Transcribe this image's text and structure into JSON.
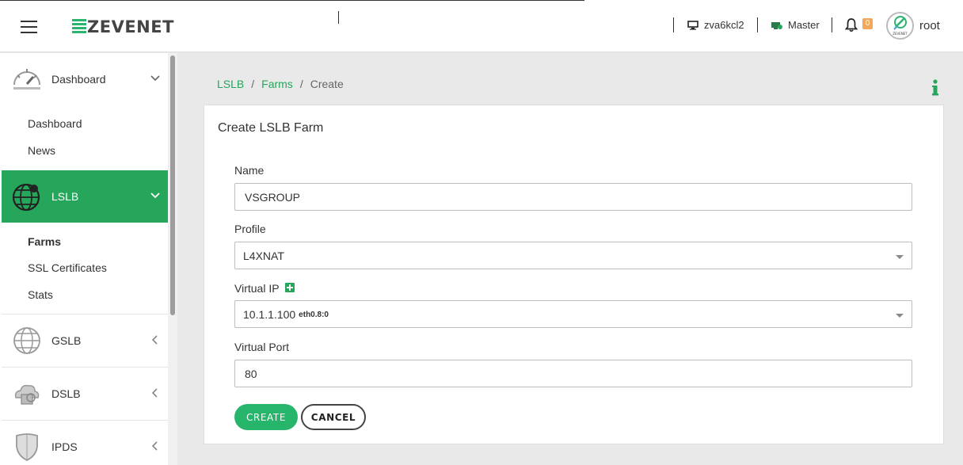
{
  "header": {
    "logo_text": "ZEVENET",
    "host": "zva6kcl2",
    "cluster_role": "Master",
    "notification_count": "0",
    "user": "root",
    "avatar_text": "ZEVENET"
  },
  "sidebar": {
    "sections": [
      {
        "label": "Dashboard",
        "items": [
          "Dashboard",
          "News"
        ]
      },
      {
        "label": "LSLB",
        "items": [
          "Farms",
          "SSL Certificates",
          "Stats"
        ]
      },
      {
        "label": "GSLB"
      },
      {
        "label": "DSLB"
      },
      {
        "label": "IPDS"
      }
    ]
  },
  "breadcrumb": {
    "items": [
      "LSLB",
      "Farms",
      "Create"
    ],
    "separator": "/"
  },
  "form": {
    "title": "Create LSLB Farm",
    "name_label": "Name",
    "name_value": "VSGROUP",
    "profile_label": "Profile",
    "profile_value": "L4XNAT",
    "vip_label": "Virtual IP",
    "vip_value": "10.1.1.100",
    "vip_interface": "eth0.8:0",
    "port_label": "Virtual Port",
    "port_value": "80",
    "create_label": "CREATE",
    "cancel_label": "CANCEL"
  },
  "colors": {
    "accent": "#26a65b",
    "badge": "#f0a85b"
  }
}
